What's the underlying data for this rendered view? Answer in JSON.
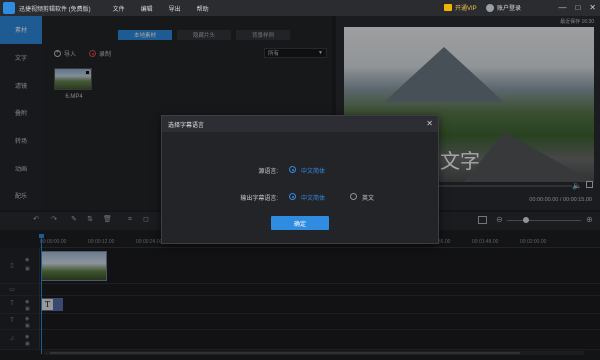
{
  "app": {
    "title": "迅捷视频剪辑软件 (免费版)"
  },
  "menu": [
    "文件",
    "编辑",
    "导出",
    "帮助"
  ],
  "header": {
    "vip_label": "开通VIP",
    "login_label": "账户登录"
  },
  "window_controls": [
    "—",
    "□",
    "✕"
  ],
  "sidebar": {
    "items": [
      {
        "label": "素材",
        "active": true
      },
      {
        "label": "文字"
      },
      {
        "label": "滤镜"
      },
      {
        "label": "叠附"
      },
      {
        "label": "转场"
      },
      {
        "label": "动画"
      },
      {
        "label": "配乐"
      }
    ]
  },
  "media": {
    "tabs": [
      {
        "label": "本地素材",
        "active": true
      },
      {
        "label": "隐藏片头"
      },
      {
        "label": "背景样例"
      }
    ],
    "import_label": "导入",
    "record_label": "录制",
    "filter_value": "所有",
    "files": [
      {
        "name": "6.MP4"
      }
    ]
  },
  "preview": {
    "autosave_label": "最近保存 16:30",
    "overlay_text": "文字",
    "timecode": "00:00:00.00 / 00:00:15.00"
  },
  "timeline": {
    "ticks": [
      "00:00:00.00",
      "00:00:12.00",
      "00:00:24.00",
      "00:00:36.00",
      "00:00:48.00",
      "00:01:00.00",
      "00:01:12.00",
      "00:01:24.00",
      "00:01:36.00",
      "00:01:48.00",
      "00:02:00.00"
    ],
    "text_clip_glyph": "T"
  },
  "dialog": {
    "title": "选择字幕语言",
    "source_label": "源语言:",
    "source_option": "中文简体",
    "output_label": "输出字幕语言:",
    "output_options": [
      {
        "label": "中文简体",
        "selected": true
      },
      {
        "label": "英文",
        "selected": false
      }
    ],
    "confirm_label": "确定"
  },
  "colors": {
    "accent": "#2f8ce0",
    "vip": "#f2c14e"
  }
}
